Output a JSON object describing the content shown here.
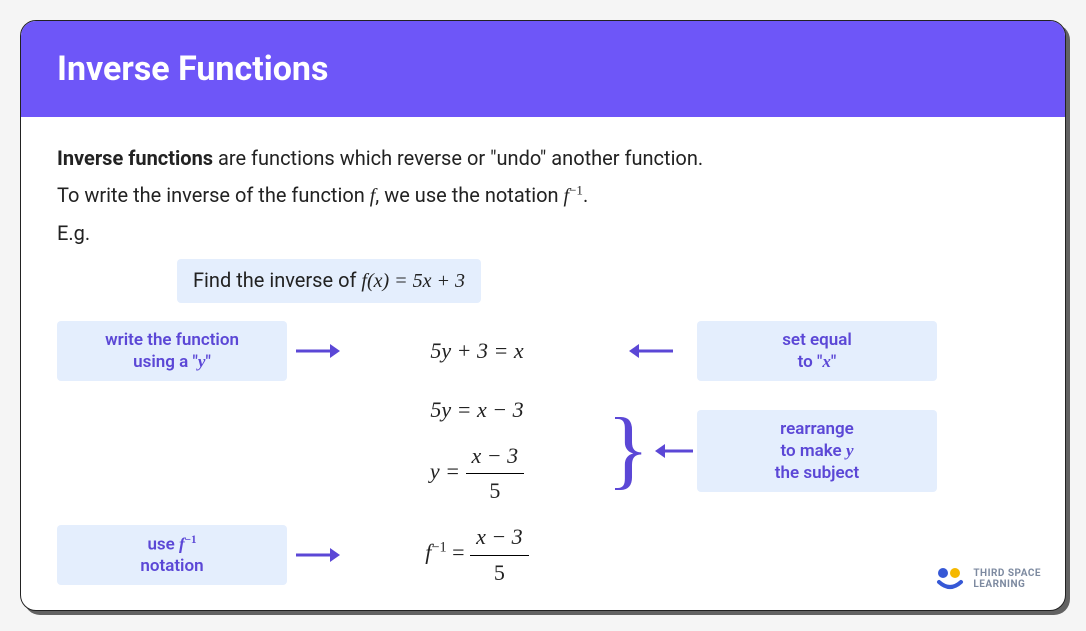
{
  "header": {
    "title": "Inverse Functions"
  },
  "intro": {
    "bold_lead": "Inverse functions",
    "line1_rest": " are functions which reverse or \"undo\" another function.",
    "line2_a": "To write the inverse of the function ",
    "line2_f": "f",
    "line2_b": ", we use the notation  ",
    "line2_finv_base": "f",
    "line2_finv_exp": "−1",
    "line2_c": ".",
    "eg": "E.g."
  },
  "example": {
    "prompt_a": "Find the inverse of ",
    "prompt_eq": "f(x) = 5x + 3"
  },
  "steps": {
    "s1": {
      "callout_a": "write the function",
      "callout_b": "using a \"",
      "callout_var": "y",
      "callout_c": "\"",
      "eqn": "5y + 3 = x",
      "right_callout_a": "set equal",
      "right_callout_b": "to \"",
      "right_callout_var": "x",
      "right_callout_c": "\""
    },
    "s2": {
      "eqn": "5y = x − 3",
      "callout_a": "rearrange",
      "callout_b": "to make ",
      "callout_var": "y",
      "callout_c": "the subject"
    },
    "s3": {
      "lhs": "y = ",
      "num": "x − 3",
      "den": "5"
    },
    "s4": {
      "callout_a": "use ",
      "callout_fn": "f",
      "callout_exp": "−1",
      "callout_b": "notation",
      "lhs_base": "f",
      "lhs_exp": "−1",
      "lhs_eq": " = ",
      "num": "x − 3",
      "den": "5"
    }
  },
  "logo": {
    "line1": "THIRD SPACE",
    "line2": "LEARNING"
  }
}
